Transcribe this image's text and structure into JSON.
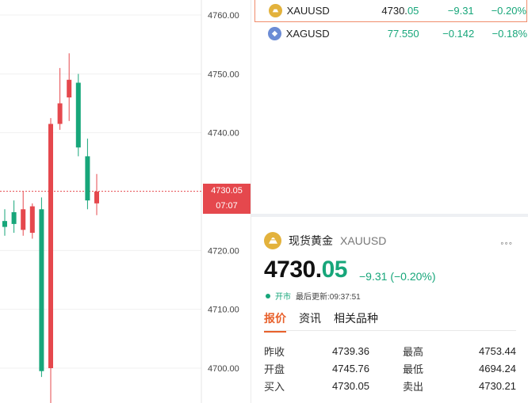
{
  "chart": {
    "price_labels": [
      "4760.00",
      "4750.00",
      "4740.00",
      "4730.05",
      "4720.00",
      "4710.00",
      "4700.00"
    ],
    "current_price": "4730.05",
    "countdown": "07:07",
    "candles": [
      {
        "o": 4725.0,
        "h": 4727.0,
        "l": 4722.5,
        "c": 4724.0
      },
      {
        "o": 4726.5,
        "h": 4728.5,
        "l": 4723.0,
        "c": 4724.5
      },
      {
        "o": 4723.5,
        "h": 4730.0,
        "l": 4722.5,
        "c": 4727.0
      },
      {
        "o": 4723.0,
        "h": 4728.0,
        "l": 4722.0,
        "c": 4727.5
      },
      {
        "o": 4727.0,
        "h": 4729.0,
        "l": 4698.5,
        "c": 4699.5
      },
      {
        "o": 4700.0,
        "h": 4742.5,
        "l": 4694.0,
        "c": 4741.5
      },
      {
        "o": 4741.5,
        "h": 4751.0,
        "l": 4740.5,
        "c": 4745.0
      },
      {
        "o": 4746.0,
        "h": 4753.5,
        "l": 4742.0,
        "c": 4749.0
      },
      {
        "o": 4748.5,
        "h": 4750.0,
        "l": 4736.0,
        "c": 4737.5
      },
      {
        "o": 4736.0,
        "h": 4739.0,
        "l": 4727.0,
        "c": 4728.5
      },
      {
        "o": 4728.0,
        "h": 4733.0,
        "l": 4726.0,
        "c": 4730.0
      }
    ]
  },
  "watchlist": [
    {
      "symbol": "XAUUSD",
      "price_main": "4730.",
      "price_dec": "05",
      "change": "−9.31",
      "pct": "−0.20%",
      "icon": "gold-coin-icon"
    },
    {
      "symbol": "XAGUSD",
      "price": "77.550",
      "change": "−0.142",
      "pct": "−0.18%",
      "icon": "silver-coin-icon"
    }
  ],
  "detail": {
    "name": "现货黄金",
    "code": "XAUUSD",
    "more": "◦◦◦",
    "price_main": "4730.",
    "price_dec": "05",
    "change": "−9.31 (−0.20%)",
    "status_open": "开市",
    "status_update": "最后更新:09:37:51",
    "tabs": [
      "报价",
      "资讯",
      "相关品种"
    ],
    "stats": [
      {
        "l1": "昨收",
        "v1": "4739.36",
        "l2": "最高",
        "v2": "4753.44"
      },
      {
        "l1": "开盘",
        "v1": "4745.76",
        "l2": "最低",
        "v2": "4694.24"
      },
      {
        "l1": "买入",
        "v1": "4730.05",
        "l2": "卖出",
        "v2": "4730.21"
      }
    ]
  },
  "colors": {
    "up": "#e5484d",
    "down": "#17a67a",
    "accent": "#e8612c"
  }
}
